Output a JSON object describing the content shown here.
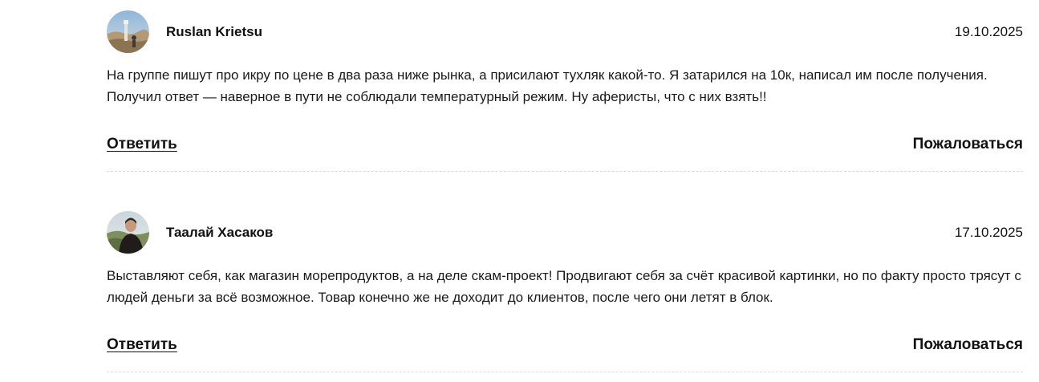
{
  "comments": [
    {
      "author": "Ruslan Krietsu",
      "date": "19.10.2025",
      "text": "На группе пишут про икру по цене в два раза ниже рынка, а присилают тухляк какой-то. Я затарился на 10к, написал им после получения. Получил ответ — наверное в пути не соблюдали температурный режим. Ну аферисты, что с них взять!!",
      "reply_label": "Ответить",
      "report_label": "Пожаловаться",
      "avatar_icon": "landscape-photo-avatar"
    },
    {
      "author": "Таалай Хасаков",
      "date": "17.10.2025",
      "text": "Выставляют себя, как магазин морепродуктов, а на деле скам-проект! Продвигают себя за счёт красивой картинки, но по факту просто трясут с людей деньги за всё возможное. Товар конечно же не доходит до клиентов, после чего они летят в блок.",
      "reply_label": "Ответить",
      "report_label": "Пожаловаться",
      "avatar_icon": "person-photo-avatar"
    }
  ]
}
